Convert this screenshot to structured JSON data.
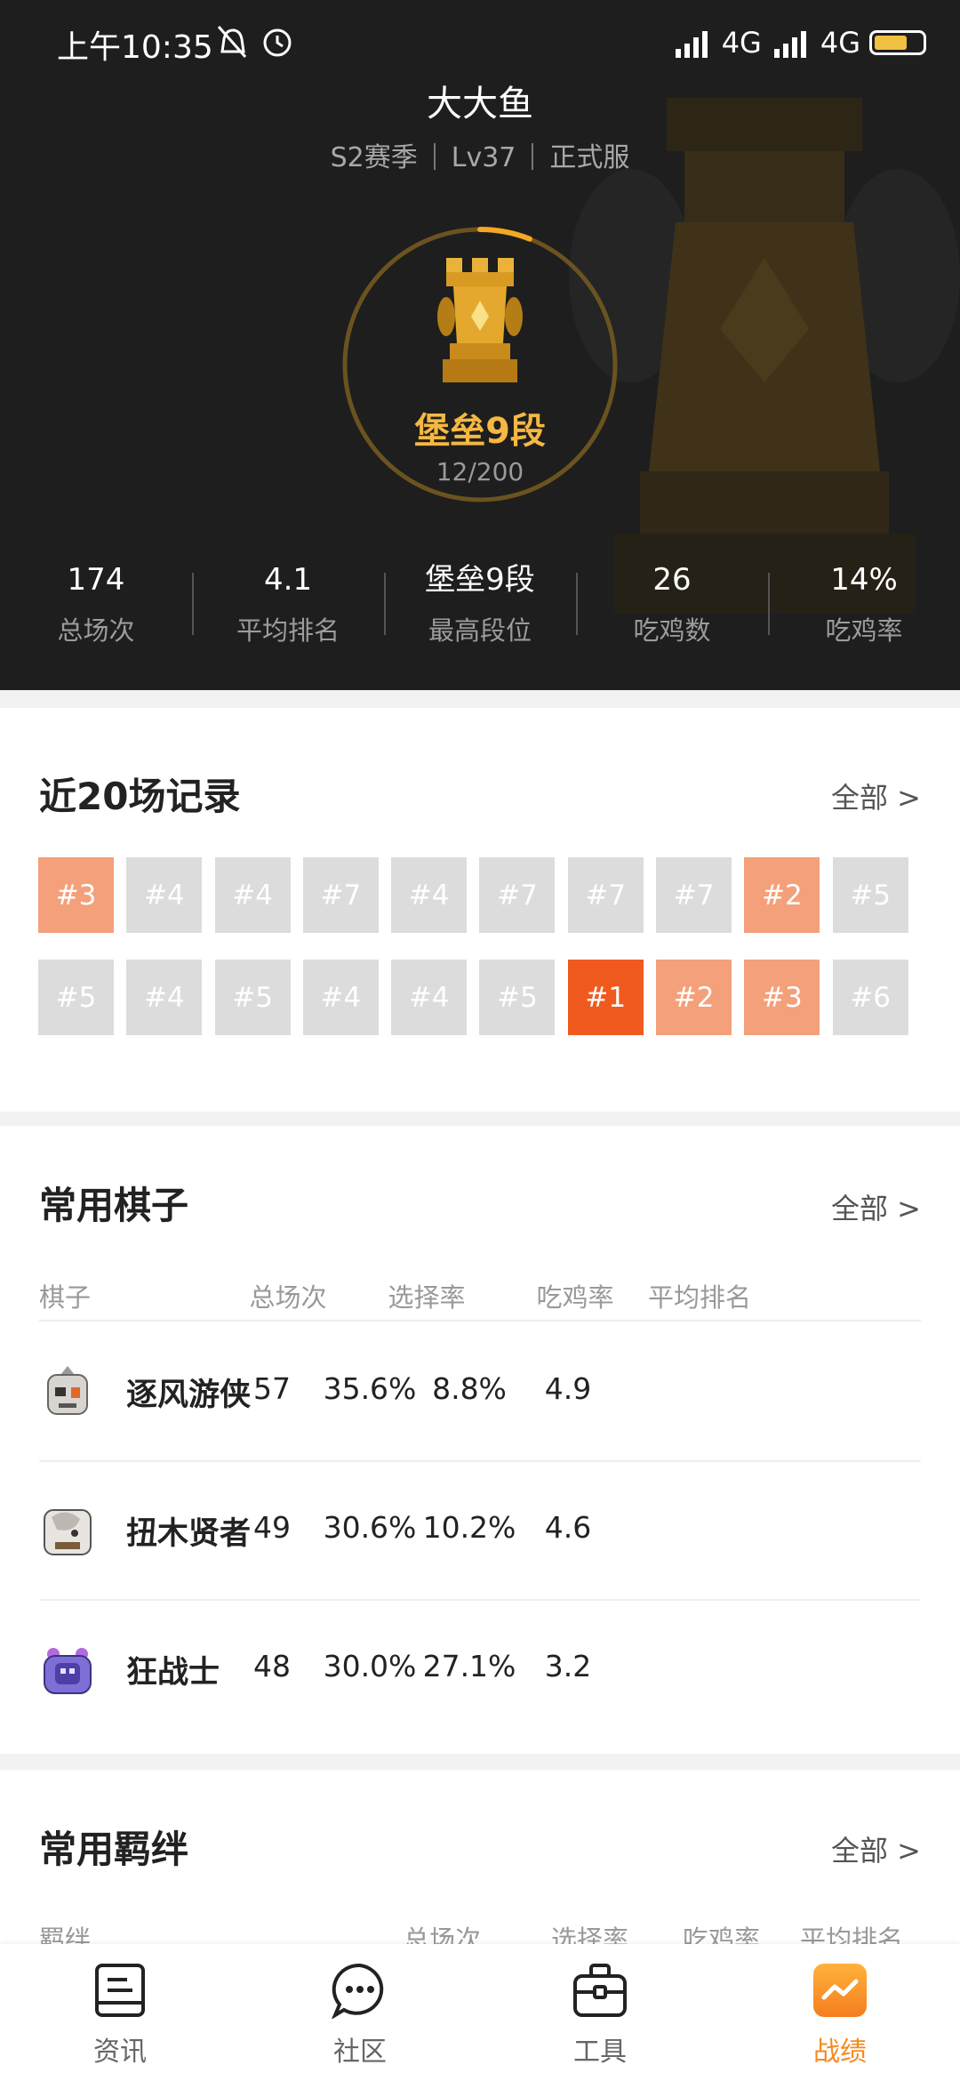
{
  "status_bar": {
    "time": "上午10:35",
    "network_1": "4G",
    "network_2": "4G",
    "battery_level": 0.7
  },
  "profile": {
    "username": "大大鱼",
    "season": "S2赛季",
    "level": "Lv37",
    "server": "正式服",
    "rank_name": "堡垒9段",
    "rank_progress": "12/200",
    "rank_progress_fraction": 0.06
  },
  "stats": [
    {
      "value": "174",
      "label": "总场次"
    },
    {
      "value": "4.1",
      "label": "平均排名"
    },
    {
      "value": "堡垒9段",
      "label": "最高段位"
    },
    {
      "value": "26",
      "label": "吃鸡数"
    },
    {
      "value": "14%",
      "label": "吃鸡率"
    }
  ],
  "records": {
    "title": "近20场记录",
    "more": "全部 >",
    "items": [
      "#3",
      "#4",
      "#4",
      "#7",
      "#4",
      "#7",
      "#7",
      "#7",
      "#2",
      "#5",
      "#5",
      "#4",
      "#5",
      "#4",
      "#4",
      "#5",
      "#1",
      "#2",
      "#3",
      "#6"
    ]
  },
  "chess": {
    "title": "常用棋子",
    "more": "全部 >",
    "headers": [
      "棋子",
      "总场次",
      "选择率",
      "吃鸡率",
      "平均排名"
    ],
    "rows": [
      {
        "name": "逐风游侠",
        "games": "57",
        "pick": "35.6%",
        "win": "8.8%",
        "avg": "4.9"
      },
      {
        "name": "扭木贤者",
        "games": "49",
        "pick": "30.6%",
        "win": "10.2%",
        "avg": "4.6"
      },
      {
        "name": "狂战士",
        "games": "48",
        "pick": "30.0%",
        "win": "27.1%",
        "avg": "3.2"
      }
    ]
  },
  "bonds": {
    "title": "常用羁绊",
    "more": "全部 >",
    "headers": [
      "羁绊",
      "总场次",
      "选择率",
      "吃鸡率",
      "平均排名"
    ]
  },
  "tabbar": [
    {
      "label": "资讯",
      "icon": "news-icon"
    },
    {
      "label": "社区",
      "icon": "chat-icon"
    },
    {
      "label": "工具",
      "icon": "toolbox-icon"
    },
    {
      "label": "战绩",
      "icon": "stats-icon",
      "active": true
    }
  ],
  "colors": {
    "accent": "#f58a1f",
    "rank_gold": "#f5b841",
    "record_top3": "#f4a07a",
    "record_first": "#f05a1f",
    "record_other": "#dcdcdc"
  }
}
